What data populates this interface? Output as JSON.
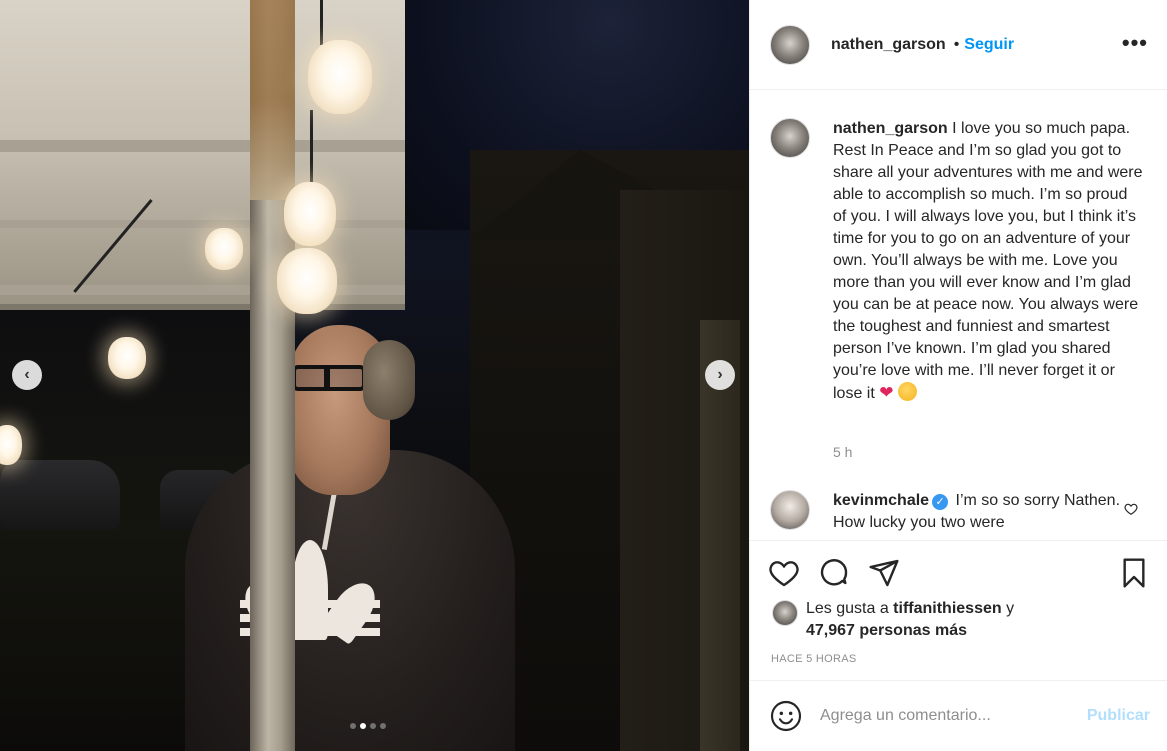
{
  "post": {
    "username": "nathen_garson",
    "dot": "•",
    "follow_label": "Seguir",
    "more_label": "•••",
    "caption_user": "nathen_garson",
    "caption_text": " I love you so much papa. Rest In Peace and I’m so glad you got to share all your adventures with me and were able to accomplish so much. I’m so proud of you. I will always love you, but I think it’s time for you to go on an adventure of your own. You’ll always be with me. Love you more than you will ever know and I’m glad you can be at peace now. You always were the toughest and funniest and smartest person I’ve known. I’m glad you shared you’re love with me. I’ll never forget it or lose it ",
    "caption_emoji_heart": "❤",
    "caption_time": "5 h"
  },
  "comments": [
    {
      "user": "kevinmchale",
      "verified_mark": "✓",
      "text": " I’m so so sorry Nathen. How lucky you two were"
    }
  ],
  "likes": {
    "prefix": "Les gusta a ",
    "user": "tiffanithiessen",
    "middle": " y",
    "count_text": "47,967 personas más"
  },
  "timestamp": "HACE 5 HORAS",
  "composer": {
    "placeholder": "Agrega un comentario...",
    "publish_label": "Publicar"
  },
  "carousel": {
    "prev_label": "‹",
    "next_label": "›",
    "slide_count": 4,
    "active_slide": 2
  },
  "colors": {
    "link_blue": "#0095f6",
    "publish_disabled": "#b2dffc",
    "verified_blue": "#3897f0",
    "muted": "#8e8e8e"
  },
  "icons": [
    "heart-icon",
    "comment-icon",
    "share-icon",
    "bookmark-icon",
    "emoji-icon",
    "more-icon",
    "chevron-left-icon",
    "chevron-right-icon"
  ]
}
